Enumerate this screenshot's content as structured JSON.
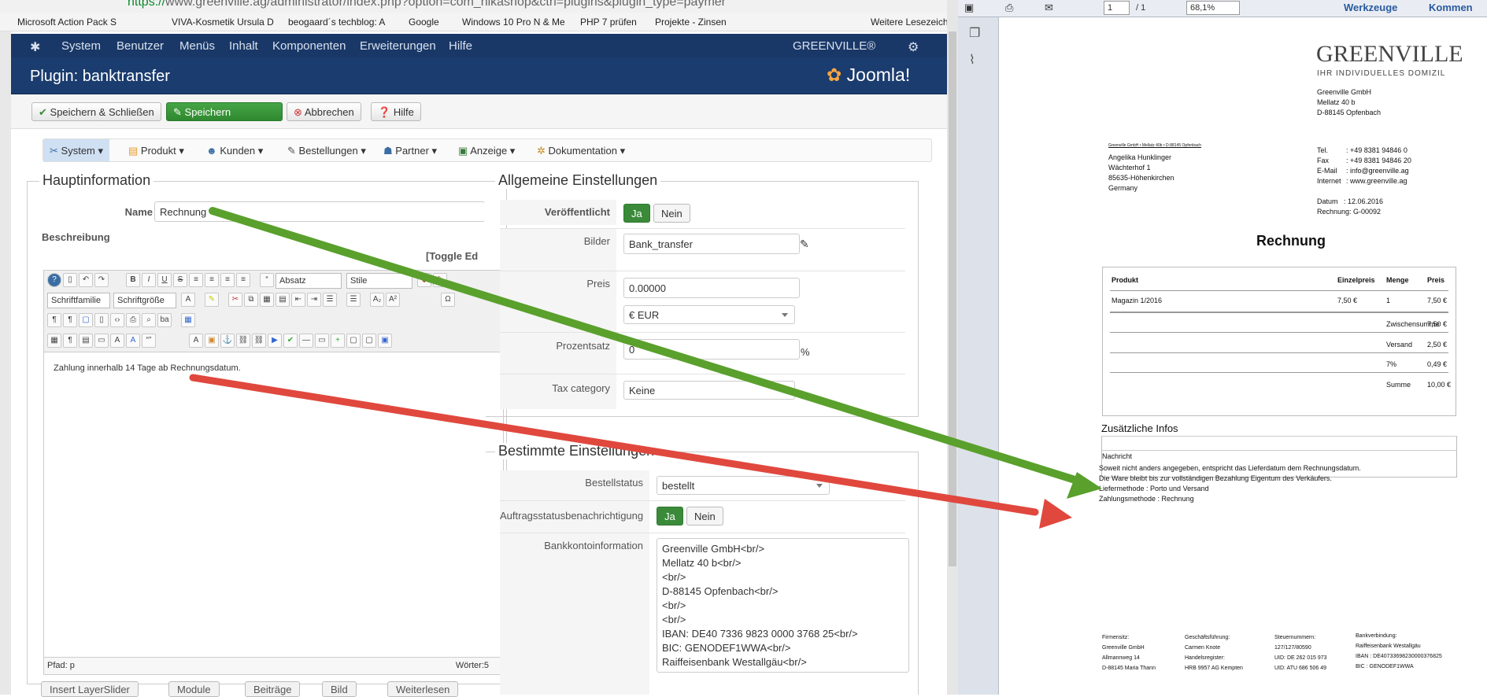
{
  "browser": {
    "url_scheme": "https://",
    "url_rest": "www.greenville.ag/administrator/index.php?option=com_hikashop&ctrl=plugins&plugin_type=paymer",
    "bookmarks": [
      "Microsoft Action Pack S",
      "VIVA-Kosmetik Ursula D",
      "beogaard´s techblog: A",
      "Google",
      "Windows 10 Pro N & Me",
      "PHP 7 prüfen",
      "Projekte - Zinsen",
      "Weitere Lesezeichen"
    ]
  },
  "nav": {
    "items": [
      "System",
      "Benutzer",
      "Menüs",
      "Inhalt",
      "Komponenten",
      "Erweiterungen",
      "Hilfe"
    ],
    "site": "GREENVILLE®"
  },
  "title": {
    "text": "Plugin: banktransfer",
    "logo": "Joomla!"
  },
  "toolbar": {
    "save_close": "Speichern & Schließen",
    "save": "Speichern",
    "cancel": "Abbrechen",
    "help": "Hilfe"
  },
  "hikamenu": [
    "System",
    "Produkt",
    "Kunden",
    "Bestellungen",
    "Partner",
    "Anzeige",
    "Dokumentation"
  ],
  "main": {
    "legend": "Hauptinformation",
    "name_label": "Name",
    "name_value": "Rechnung",
    "desc_label": "Beschreibung",
    "toggle": "[Toggle Ed"
  },
  "editor": {
    "format": "Absatz",
    "style": "Stile",
    "font": "Schriftfamilie",
    "size": "Schriftgröße",
    "content": "Zahlung innerhalb 14 Tage ab Rechnungsdatum.",
    "path": "Pfad:  p",
    "words": "Wörter:5"
  },
  "general": {
    "legend": "Allgemeine Einstellungen",
    "published_label": "Veröffentlicht",
    "yes": "Ja",
    "no": "Nein",
    "images_label": "Bilder",
    "images_value": "Bank_transfer",
    "price_label": "Preis",
    "price_value": "0.00000",
    "currency": "€ EUR",
    "percent_label": "Prozentsatz",
    "percent_value": "0",
    "percent_sign": "%",
    "tax_label": "Tax category",
    "tax_value": "Keine"
  },
  "specific": {
    "legend": "Bestimmte Einstellungen",
    "order_status_label": "Bestellstatus",
    "order_status_value": "bestellt",
    "notify_label": "Auftragsstatusbenachrichtigung",
    "bank_label": "Bankkontoinformation",
    "bank_lines": [
      "Greenville GmbH<br/>",
      "Mellatz 40 b<br/>",
      "<br/>",
      "D-88145 Opfenbach<br/>",
      "<br/>",
      "<br/>",
      "IBAN: DE40 7336 9823 0000 3768 25<br/>",
      "BIC: GENODEF1WWA<br/>",
      "Raiffeisenbank Westallgäu<br/>"
    ]
  },
  "bottom": [
    "Insert LayerSlider",
    "Module",
    "Beiträge",
    "Bild",
    "Weiterlesen"
  ],
  "pdf": {
    "page": "1",
    "pages": "/ 1",
    "zoom": "68,1%",
    "tools": "Werkzeuge",
    "comment": "Kommen",
    "logo": "GREENVILLE",
    "slogan": "IHR INDIVIDUELLES DOMIZIL",
    "sender": [
      "Greenville GmbH",
      "Mellatz 40 b",
      "D-88145 Opfenbach"
    ],
    "return_line": "Greenville GmbH • Mellatz 40b • D-88145 Opfenbach",
    "recipient": [
      "Angelika Hunklinger",
      "Wächterhof 1",
      "85635-Höhenkirchen",
      "Germany"
    ],
    "contact": [
      [
        "Tel.",
        ": +49 8381 94846 0"
      ],
      [
        "Fax",
        ": +49 8381 94846 20"
      ],
      [
        "E-Mail",
        ": info@greenville.ag"
      ],
      [
        "Internet",
        ": www.greenville.ag"
      ]
    ],
    "date": [
      "Datum",
      ": 12.06.2016"
    ],
    "invoice_no": "Rechnung: G-00092",
    "heading": "Rechnung",
    "table_head": [
      "Produkt",
      "Einzelpreis",
      "Menge",
      "Preis"
    ],
    "item": [
      "Magazin 1/2016",
      "7,50 €",
      "1",
      "7,50 €"
    ],
    "totals": [
      [
        "Zwischensumme",
        "7,50 €"
      ],
      [
        "Versand",
        "2,50 €"
      ],
      [
        "7%",
        "0,49 €"
      ],
      [
        "Summe",
        "10,00 €"
      ]
    ],
    "extra_title": "Zusätzliche Infos",
    "extra_msg": "Nachricht",
    "notes": [
      "Soweit nicht anders angegeben, entspricht das Lieferdatum dem Rechnungsdatum.",
      "Die Ware bleibt bis zur vollständigen Bezahlung Eigentum des Verkäufers.",
      "Liefermethode : Porto und Versand",
      "Zahlungsmethode : Rechnung"
    ],
    "footer": [
      [
        "Firmensitz:",
        "Greenville GmbH",
        "Allmannweg 14",
        "D-88145 Maria Thann"
      ],
      [
        "Geschäftsführung:",
        "Carmen Knote",
        "Handelsregister:",
        "HRB 9957 AG Kempten"
      ],
      [
        "Steuernummern:",
        "127/127/80590",
        "UID: DE 262 015 973",
        "UID: ATU 686 506 49"
      ],
      [
        "Bankverbindung:",
        "Raiffeisenbank Westallgäu",
        "IBAN : DE40733698230000376825",
        "BIC   : GENODEF1WWA"
      ]
    ]
  }
}
